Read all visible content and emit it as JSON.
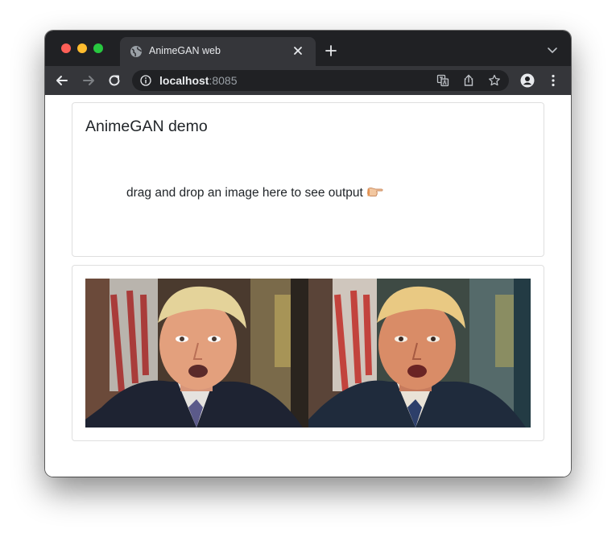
{
  "browser": {
    "tab": {
      "title": "AnimeGAN web",
      "icon": "globe-icon"
    },
    "address": {
      "host": "localhost",
      "port": ":8085"
    },
    "colors": {
      "tab_bar": "#202124",
      "toolbar": "#35363a",
      "omnibox": "#202124"
    }
  },
  "page": {
    "title": "AnimeGAN demo",
    "dropzone_text": "drag and drop an image here to see output",
    "dropzone_icon": "pointing-hand-icon",
    "images": [
      {
        "role": "input-photo"
      },
      {
        "role": "anime-output-photo"
      }
    ],
    "colors": {
      "card_border": "#dfdfdf",
      "text": "#212529"
    }
  }
}
